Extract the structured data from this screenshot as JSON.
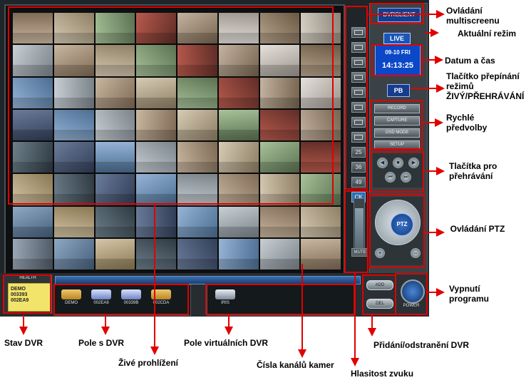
{
  "app": {
    "brand_logo": "DVRCLIENT",
    "mode_badge": "LIVE",
    "date": "09-10  FRI",
    "time": "14:13:25",
    "playback_toggle": "PB",
    "quick_buttons": [
      "RECORD",
      "CAPTURE",
      "OSD MODE",
      "SETUP"
    ],
    "ptz_label": "PTZ",
    "layout_numbers": [
      "25",
      "36",
      "49"
    ],
    "cameras_button": "CK",
    "mute_label": "MUTE",
    "mute_glyph": "◄)",
    "health_title": "HEALTH",
    "health_lines": [
      "DEMO",
      "003393",
      "002EA9"
    ],
    "dvr_items": [
      "DEMO",
      "002EA9",
      "00339B",
      "002CDA"
    ],
    "virtual_dvr_items": [
      "IRIS"
    ],
    "power_label": "POWER",
    "add_labels": [
      "ADD",
      "DEL"
    ],
    "volume_level": 0.85
  },
  "annotations": {
    "multiscreen": "Ovládání multiscreenu",
    "current_mode": "Aktuální režim",
    "datetime": "Datum a čas",
    "live_pb_toggle": "Tlačítko přepínání režimů ŽIVÝ/PŘEHRÁVÁNÍ",
    "quick_presets": "Rychlé předvolby",
    "playback_buttons": "Tlačítka pro přehrávání",
    "ptz_control": "Ovládání PTZ",
    "exit_program": "Vypnutí programu",
    "dvr_status": "Stav DVR",
    "dvr_field": "Pole s DVR",
    "virtual_dvr_field": "Pole virtuálních DVR",
    "add_remove_dvr": "Přidání/odstranění DVR",
    "live_view": "Živé prohlížení",
    "camera_channels": "Čísla kanálů kamer",
    "volume": "Hlasitost zvuku"
  },
  "colors": {
    "accent_red": "#e00000",
    "panel_dark": "#1f2528",
    "date_blue": "#0a48c8",
    "health_yellow": "#f2e46a"
  },
  "thumbnail_palette": [
    [
      "#c9b7a0",
      "#7f6a55"
    ],
    [
      "#d9d3c8",
      "#8c8478"
    ],
    [
      "#96b4d6",
      "#4b6e92"
    ],
    [
      "#e5e1dc",
      "#9c948c"
    ],
    [
      "#6d7f8b",
      "#2f3a42"
    ],
    [
      "#b85a4c",
      "#5f2d27"
    ],
    [
      "#8fa9c4",
      "#46607b"
    ],
    [
      "#d7cbb5",
      "#8e7f64"
    ],
    [
      "#a3b7c9",
      "#5c7286"
    ],
    [
      "#c8cfd4",
      "#7a838a"
    ],
    [
      "#b9a68f",
      "#6a5844"
    ],
    [
      "#6a7c9a",
      "#323e57"
    ],
    [
      "#c4b3a1",
      "#76644f"
    ],
    [
      "#d4c6a8",
      "#8a7752"
    ],
    [
      "#a8c29a",
      "#5a7150"
    ],
    [
      "#9aa7b5",
      "#4f5a66"
    ]
  ]
}
